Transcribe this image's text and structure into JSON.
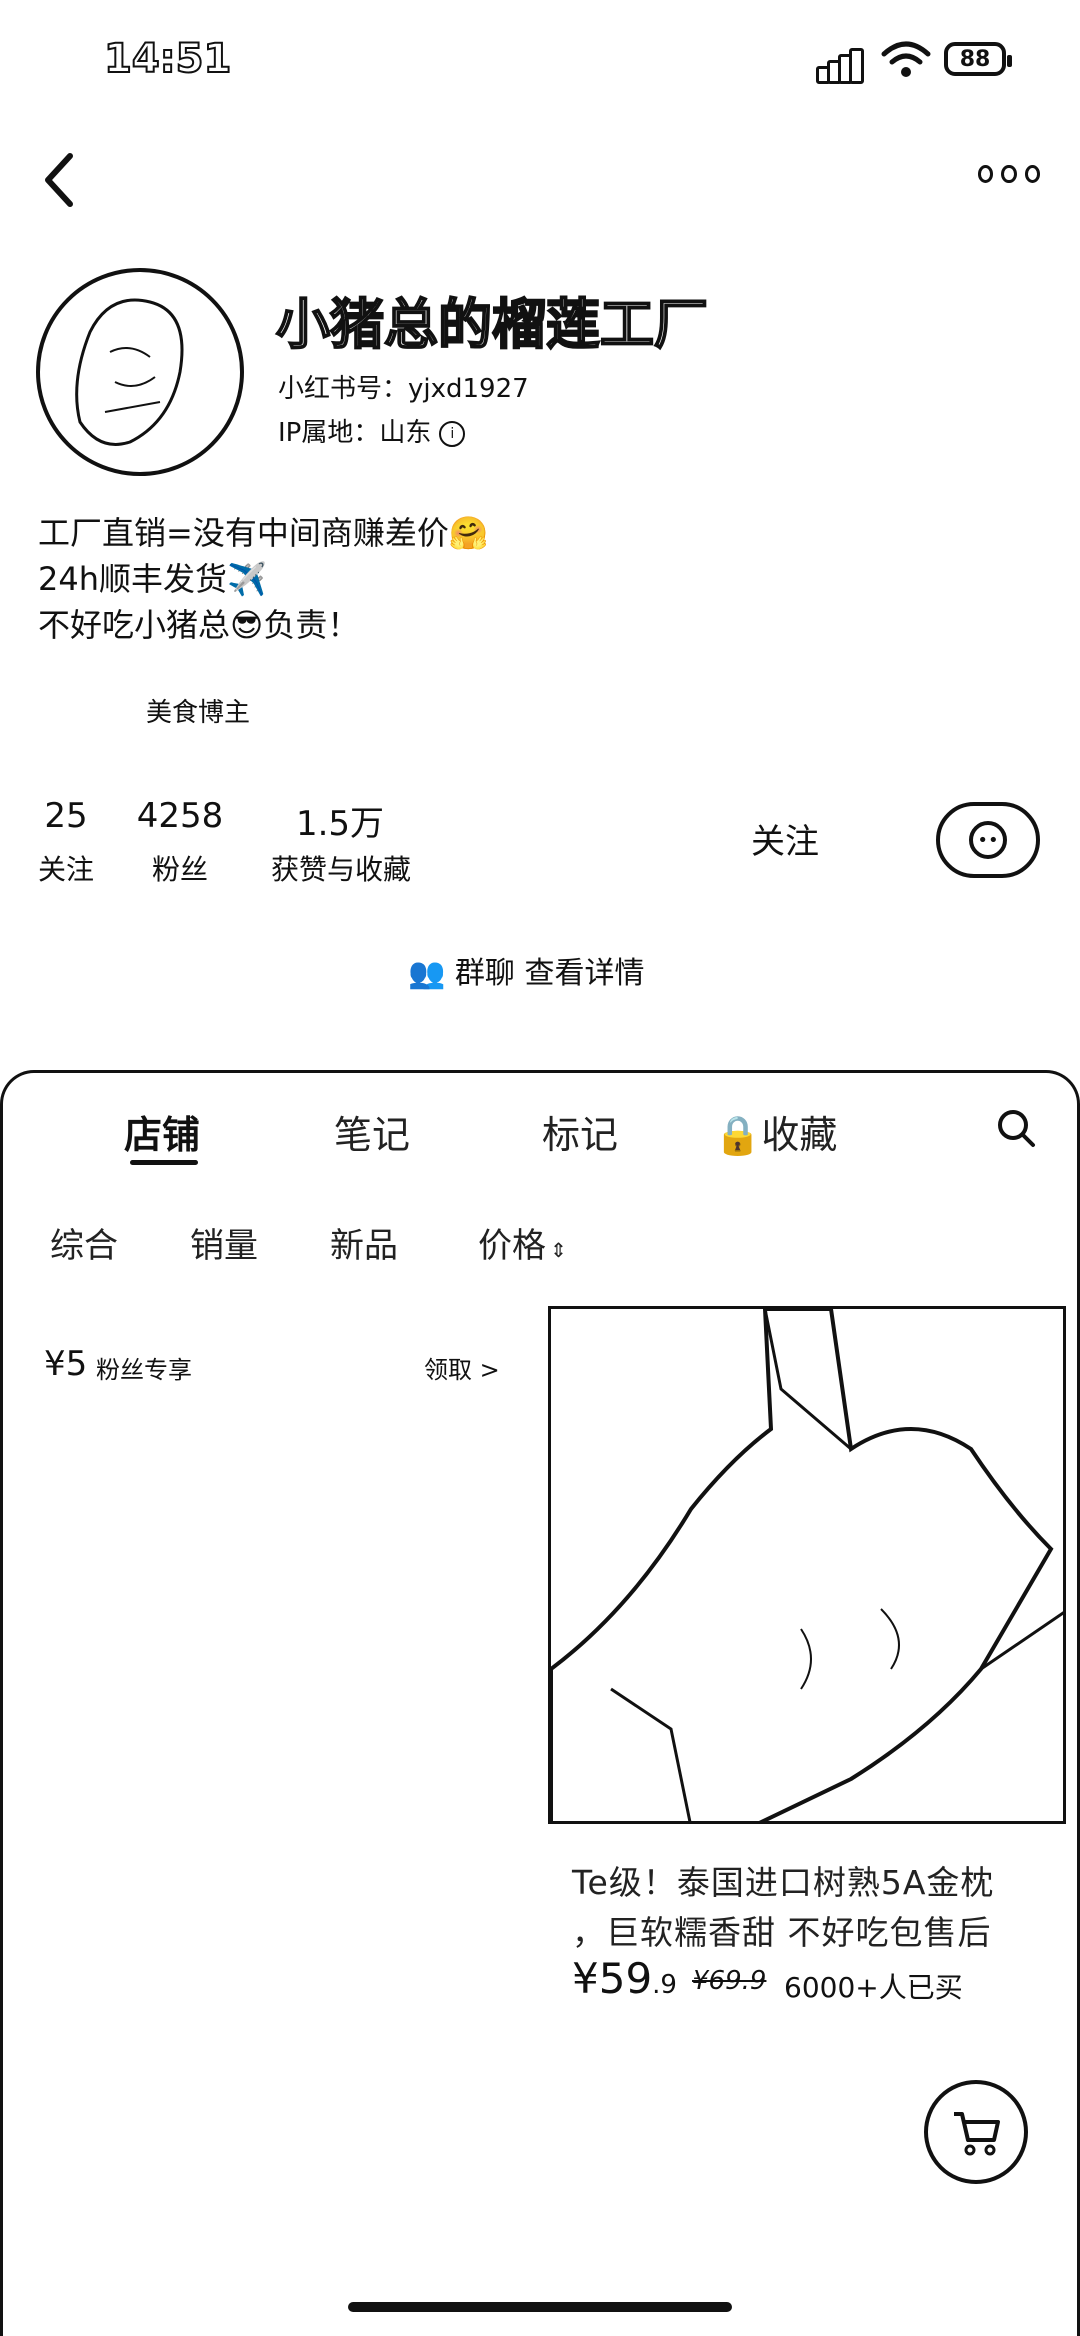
{
  "status": {
    "time": "14:51",
    "battery": "88"
  },
  "profile": {
    "name": "小猪总的榴莲工厂",
    "red_id": "小红书号：yjxd1927",
    "ip": "IP属地：山东",
    "bio": [
      "工厂直销=没有中间商赚差价🤗",
      "24h顺丰发货✈️",
      "不好吃小猪总😎负责！"
    ],
    "tag": "美食博主",
    "stats": [
      {
        "num": "25",
        "label": "关注"
      },
      {
        "num": "4258",
        "label": "粉丝"
      },
      {
        "num": "1.5万",
        "label": "获赞与收藏"
      }
    ],
    "follow_label": "关注",
    "group_label": "群聊 查看详情"
  },
  "tabs": [
    "店铺",
    "笔记",
    "标记",
    "收藏"
  ],
  "filters": [
    "综合",
    "销量",
    "新品",
    "价格"
  ],
  "coupon": {
    "amount": "¥5",
    "desc": "粉丝专享",
    "claim": "领取 >"
  },
  "product": {
    "title_line1": "Te级！泰国进口树熟5A金枕",
    "title_line2": "，巨软糯香甜 不好吃包售后",
    "price": "¥59",
    "price_decimal": ".9",
    "old_price": "¥69.9",
    "sold": "6000+人已买"
  }
}
